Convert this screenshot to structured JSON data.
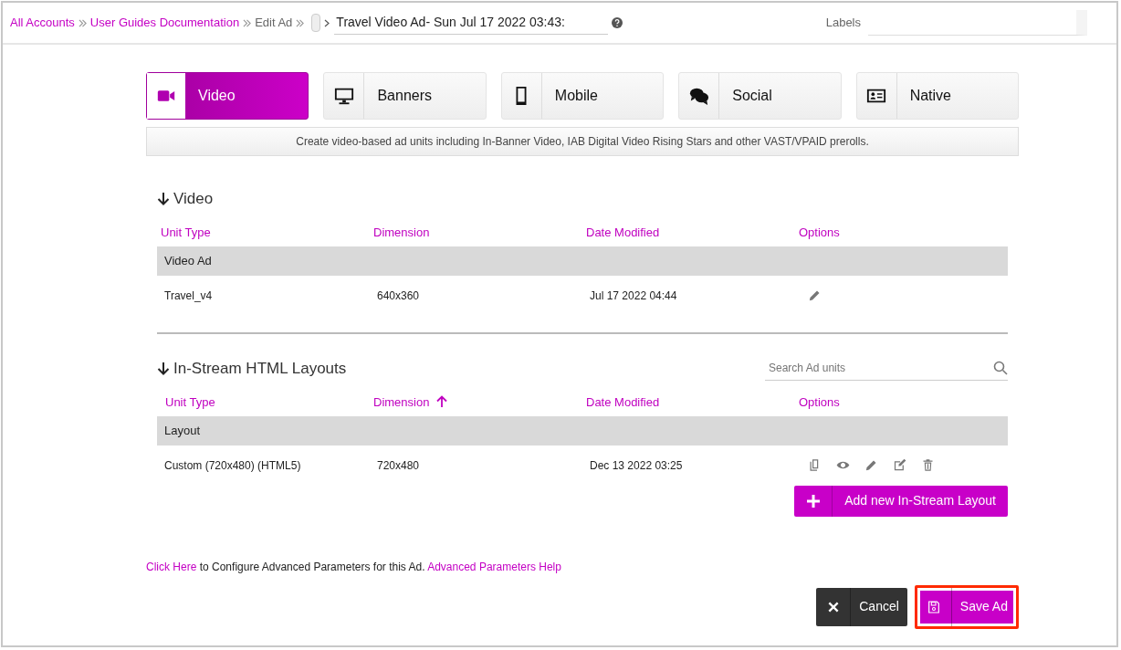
{
  "breadcrumb": [
    {
      "label": "All Accounts",
      "kind": "link"
    },
    {
      "label": "User Guides Documentation",
      "kind": "link"
    },
    {
      "label": "Edit Ad",
      "kind": "text"
    }
  ],
  "title_field": {
    "value": "Travel Video Ad- Sun Jul 17 2022 03:43:"
  },
  "labels_field": {
    "label": "Labels"
  },
  "tabs": [
    {
      "label": "Video",
      "kind": "video",
      "selected": true
    },
    {
      "label": "Banners",
      "kind": "monitor",
      "selected": false
    },
    {
      "label": "Mobile",
      "kind": "phone",
      "selected": false
    },
    {
      "label": "Social",
      "kind": "chat",
      "selected": false
    },
    {
      "label": "Native",
      "kind": "card",
      "selected": false
    }
  ],
  "description": "Create video-based ad units including In-Banner Video, IAB Digital Video Rising Stars and other VAST/VPAID prerolls.",
  "sections": [
    {
      "title": "Video",
      "columns": [
        {
          "label": "Unit Type",
          "sorted": false
        },
        {
          "label": "Dimension",
          "sorted": false
        },
        {
          "label": "Date Modified",
          "sorted": false
        },
        {
          "label": "Options",
          "sorted": false
        }
      ],
      "group": "Video Ad",
      "rows": [
        {
          "cells": [
            "Travel_v4",
            "640x360",
            "Jul 17 2022 04:44"
          ],
          "options": [
            {
              "kind": "pencil"
            }
          ]
        }
      ]
    },
    {
      "title": "In-Stream HTML Layouts",
      "search": {
        "placeholder": "Search Ad units"
      },
      "columns": [
        {
          "label": "Unit Type",
          "sorted": false
        },
        {
          "label": "Dimension",
          "sorted": true
        },
        {
          "label": "Date Modified",
          "sorted": false
        },
        {
          "label": "Options",
          "sorted": false
        }
      ],
      "group": "Layout",
      "rows": [
        {
          "cells": [
            "Custom (720x480) (HTML5)",
            "720x480",
            "Dec 13 2022 03:25"
          ],
          "options": [
            {
              "kind": "copy"
            },
            {
              "kind": "eye"
            },
            {
              "kind": "pencil"
            },
            {
              "kind": "edit"
            },
            {
              "kind": "trash"
            }
          ]
        }
      ],
      "button": {
        "label": "Add new In-Stream Layout"
      }
    }
  ],
  "footer_text": [
    {
      "text": "Click Here",
      "kind": "link"
    },
    {
      "text": "to Configure Advanced Parameters for this Ad.",
      "kind": "text"
    },
    {
      "text": "Advanced Parameters Help",
      "kind": "link"
    }
  ],
  "actions": [
    {
      "label": "Cancel",
      "kind": "cancel",
      "highlighted": false
    },
    {
      "label": "Save Ad",
      "kind": "save",
      "highlighted": true
    }
  ]
}
